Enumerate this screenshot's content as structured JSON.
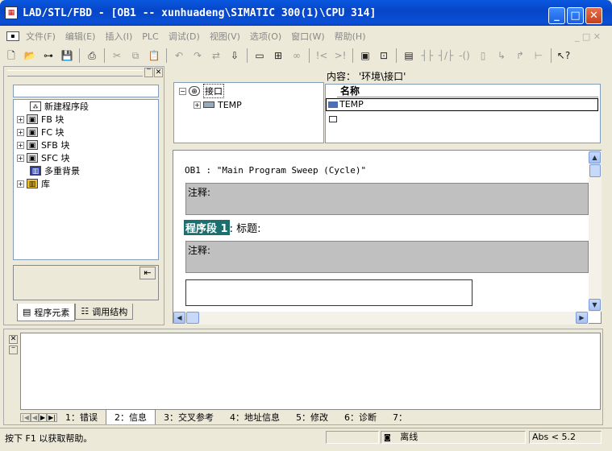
{
  "window": {
    "title": "LAD/STL/FBD  - [OB1 -- xunhuadeng\\SIMATIC 300(1)\\CPU 314]",
    "minimize_label": "_",
    "maximize_label": "□",
    "close_label": "✕"
  },
  "menubar": {
    "items": [
      "文件(F)",
      "编辑(E)",
      "插入(I)",
      "PLC",
      "调试(D)",
      "视图(V)",
      "选项(O)",
      "窗口(W)",
      "帮助(H)"
    ],
    "mdi_controls": "_ □ ✕"
  },
  "left_tree": {
    "items": [
      {
        "label": "新建程序段",
        "icon": "network-icon",
        "expandable": false
      },
      {
        "label": "FB 块",
        "icon": "block-icon",
        "expandable": true
      },
      {
        "label": "FC 块",
        "icon": "block-icon",
        "expandable": true
      },
      {
        "label": "SFB 块",
        "icon": "block-icon",
        "expandable": true
      },
      {
        "label": "SFC 块",
        "icon": "block-icon",
        "expandable": true
      },
      {
        "label": "多重背景",
        "icon": "multi-instance-icon",
        "expandable": false
      },
      {
        "label": "库",
        "icon": "library-icon",
        "expandable": true
      }
    ],
    "tabs": [
      "程序元素",
      "调用结构"
    ],
    "panel_close": "✕",
    "panel_float": "‾"
  },
  "interface_tree": {
    "root": "接口",
    "child": "TEMP"
  },
  "content_table": {
    "title": "内容： '环境\\接口'",
    "header": "名称",
    "rows": [
      "TEMP",
      ""
    ]
  },
  "editor": {
    "block_header": "OB1 :  \"Main Program Sweep (Cycle)\"",
    "comment_label_1": "注释:",
    "network_label": "程序段 1",
    "network_title": ": 标题:",
    "comment_label_2": "注释:"
  },
  "output_tabs": [
    "1：错误",
    "2：信息",
    "3：交叉参考",
    "4：地址信息",
    "5：修改",
    "6：诊断",
    "7："
  ],
  "output_nav": [
    "|◀",
    "◀",
    "▶",
    "▶|"
  ],
  "statusbar": {
    "help_text": "按下 F1 以获取帮助。",
    "connection": "离线",
    "address_mode": "Abs < 5.2"
  }
}
